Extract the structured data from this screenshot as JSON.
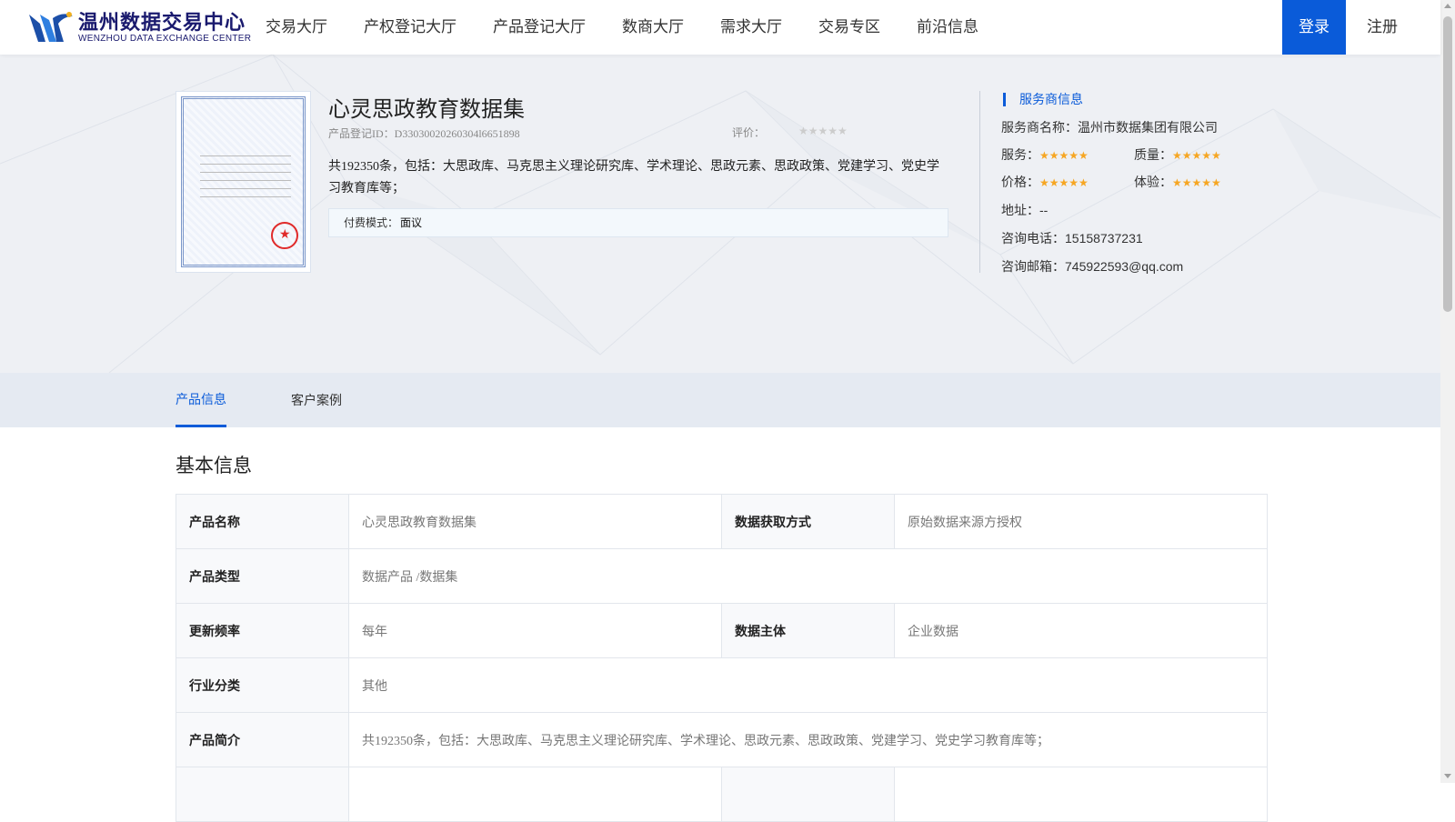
{
  "header": {
    "logo_cn": "温州数据交易中心",
    "logo_en": "WENZHOU DATA EXCHANGE CENTER",
    "nav": [
      "交易大厅",
      "产权登记大厅",
      "产品登记大厅",
      "数商大厅",
      "需求大厅",
      "交易专区",
      "前沿信息"
    ],
    "login": "登录",
    "register": "注册"
  },
  "product": {
    "title": "心灵思政教育数据集",
    "id_label": "产品登记ID：D33030020260304l6651898",
    "rating_label": "评价：",
    "rating_stars": "★★★★★",
    "rating_value": 0,
    "description": "共192350条，包括：大思政库、马克思主义理论研究库、学术理论、思政元素、思政政策、党建学习、党史学习教育库等；",
    "pay_label": "付费模式：",
    "pay_value": "面议"
  },
  "provider": {
    "title": "服务商信息",
    "name_label": "服务商名称：",
    "name": "温州市数据集团有限公司",
    "service_label": "服务：",
    "quality_label": "质量：",
    "price_label": "价格：",
    "experience_label": "体验：",
    "stars": "★★★★★",
    "service_rating": 5,
    "quality_rating": 5,
    "price_rating": 5,
    "experience_rating": 5,
    "address_label": "地址：",
    "address": "--",
    "phone_label": "咨询电话：",
    "phone": "15158737231",
    "email_label": "咨询邮箱：",
    "email": "745922593@qq.com"
  },
  "tabs": {
    "product_info": "产品信息",
    "customer_cases": "客户案例"
  },
  "basic_info": {
    "title": "基本信息",
    "rows": {
      "name_k": "产品名称",
      "name_v": "心灵思政教育数据集",
      "source_k": "数据获取方式",
      "source_v": "原始数据来源方授权",
      "type_k": "产品类型",
      "type_v": "数据产品 /数据集",
      "freq_k": "更新频率",
      "freq_v": "每年",
      "subject_k": "数据主体",
      "subject_v": "企业数据",
      "industry_k": "行业分类",
      "industry_v": "其他",
      "intro_k": "产品简介",
      "intro_v": "共192350条，包括：大思政库、马克思主义理论研究库、学术理论、思政元素、思政政策、党建学习、党史学习教育库等；"
    }
  },
  "colors": {
    "accent": "#0a5bd9",
    "star": "#f6a623",
    "hero_bg": "#eef0f4",
    "tab_bg": "#e5eaf2"
  }
}
